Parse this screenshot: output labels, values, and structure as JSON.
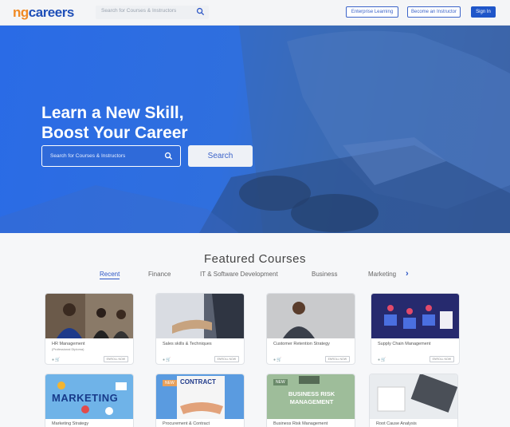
{
  "header": {
    "logo_part1": "ng",
    "logo_part2": "careers",
    "search_placeholder": "Search for Courses & Instructors",
    "enterprise_label": "Enterprise Learning",
    "instructor_label": "Become an Instructor",
    "signin_label": "Sign In"
  },
  "hero": {
    "title_line1": "Learn a New Skill,",
    "title_line2": "Boost Your Career",
    "search_placeholder": "Search for Courses & Instructors",
    "search_button": "Search"
  },
  "featured": {
    "title": "Featured Courses",
    "tabs": [
      "Recent",
      "Finance",
      "IT & Software Development",
      "Business",
      "Marketing"
    ],
    "active_tab": "Recent"
  },
  "courses": [
    {
      "title": "HR Management",
      "subtitle": "(Professional Diploma)",
      "enroll": "ENROLL NOW"
    },
    {
      "title": "Sales skills & Techniques",
      "subtitle": "",
      "enroll": "ENROLL NOW"
    },
    {
      "title": "Customer Retention Strategy",
      "subtitle": "",
      "enroll": "ENROLL NOW"
    },
    {
      "title": "Supply Chain Management",
      "subtitle": "",
      "enroll": "ENROLL NOW"
    },
    {
      "title": "Marketing Strategy",
      "subtitle": "",
      "banner": "MARKETING"
    },
    {
      "title": "Procurement & Contract",
      "subtitle": "",
      "banner": "CONTRACT",
      "tag": "NEW"
    },
    {
      "title": "Business Risk Management",
      "subtitle": "",
      "banner": "BUSINESS RISK MANAGEMENT",
      "tag": "NEW"
    },
    {
      "title": "Root Cause Analysis",
      "subtitle": ""
    }
  ],
  "colors": {
    "brand_orange": "#f08a24",
    "brand_blue": "#1f56c9",
    "hero_blue": "#2a6be6"
  }
}
